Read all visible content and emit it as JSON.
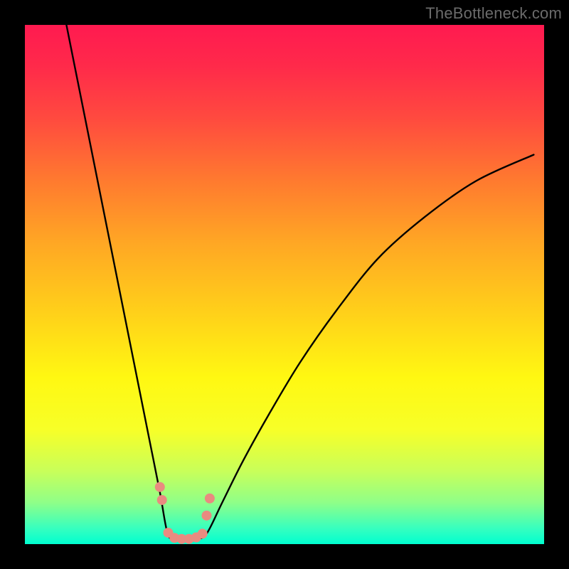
{
  "watermark": "TheBottleneck.com",
  "colors": {
    "frame": "#000000",
    "gradient_top": "#ff1a50",
    "gradient_bottom": "#00ffd0",
    "curve": "#000000",
    "marker": "#e98b80",
    "watermark_text": "#6b6b6b"
  },
  "chart_data": {
    "type": "line",
    "title": "",
    "xlabel": "",
    "ylabel": "",
    "xlim": [
      0,
      100
    ],
    "ylim": [
      0,
      100
    ],
    "grid": false,
    "legend": false,
    "notes": "Bottleneck-style curve: two monotone branches descending to a flat minimum near the bottom. Background is a red→yellow→green vertical gradient. Small salmon markers cluster around the valley floor near x≈27–35.",
    "series": [
      {
        "name": "left-branch",
        "x": [
          8,
          10,
          12,
          14,
          16,
          18,
          20,
          22,
          24,
          26,
          27.5
        ],
        "y": [
          100,
          90,
          80,
          70,
          60,
          50,
          40,
          30,
          20,
          10,
          2
        ]
      },
      {
        "name": "valley-floor",
        "x": [
          27.5,
          29,
          31,
          33,
          35
        ],
        "y": [
          2,
          1,
          1,
          1,
          2
        ]
      },
      {
        "name": "right-branch",
        "x": [
          35,
          38,
          42,
          47,
          53,
          60,
          68,
          77,
          87,
          98
        ],
        "y": [
          2,
          8,
          16,
          25,
          35,
          45,
          55,
          63,
          70,
          75
        ]
      }
    ],
    "markers": {
      "name": "valley-points",
      "color": "#e98b80",
      "x": [
        26.0,
        26.4,
        27.6,
        28.8,
        30.2,
        31.6,
        33.0,
        34.2,
        35.0,
        35.6
      ],
      "y": [
        11.0,
        8.5,
        2.2,
        1.2,
        1.0,
        1.0,
        1.3,
        2.0,
        5.5,
        8.8
      ]
    }
  }
}
